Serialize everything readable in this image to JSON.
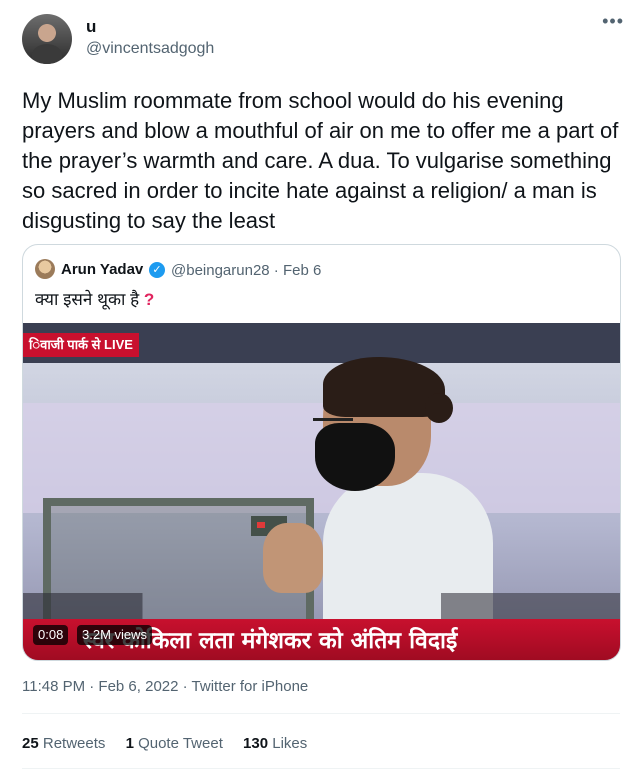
{
  "author": {
    "display_name": "u",
    "handle": "@vincentsadgogh",
    "more_icon": "more-horizontal-icon"
  },
  "tweet": {
    "text": "My Muslim roommate from school would do his evening prayers and blow a mouthful of air on me to offer me a part of the prayer’s warmth and care. A dua. To vulgarise something so sacred in order to incite hate against a religion/ a man is disgusting to say the least"
  },
  "quote": {
    "name": "Arun Yadav",
    "verified_icon": "verified-badge-icon",
    "handle_date": "@beingarun28 · Feb 6",
    "text": "क्या इसने थूका है",
    "text_suffix": "?",
    "video": {
      "live_tag": "िवाजी पार्क से LIVE",
      "ticker": "स्वर कोकिला लता मंगेशकर को अंतिम विदाई",
      "time": "0:08",
      "views": "3.2M views"
    }
  },
  "meta": {
    "timestamp": "11:48 PM · Feb 6, 2022 · Twitter for iPhone"
  },
  "stats": {
    "retweets_count": "25",
    "retweets_label": "Retweets",
    "quote_count": "1",
    "quote_label": "Quote Tweet",
    "likes_count": "130",
    "likes_label": "Likes"
  },
  "colors": {
    "accent": "#1d9bf0",
    "ticker_red": "#c8102e",
    "muted_text": "#536471"
  }
}
